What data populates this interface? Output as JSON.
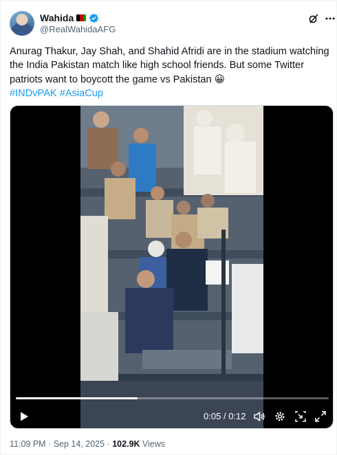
{
  "author": {
    "display_name": "Wahida",
    "handle": "@RealWahidaAFG",
    "flag_colors": [
      "#000000",
      "#be0000",
      "#009900"
    ],
    "avatar_icon": "profile-photo",
    "verified_icon": "verified-badge-icon"
  },
  "tweet": {
    "text_line1": "Anurag Thakur, Jay Shah, and Shahid Afridi are in the stadium watching",
    "text_line2": "the India Pakistan match like high school friends. But some Twitter",
    "text_line3": "patriots want to boycott the game vs Pakistan 😀",
    "hashtag1": "#INDvPAK",
    "hashtag2": "#AsiaCup"
  },
  "video": {
    "current_time": "0:05",
    "separator": "/",
    "duration": "0:12",
    "progress_fraction": 0.39,
    "controls": [
      "play-icon",
      "volume-icon",
      "settings-gear-icon",
      "picture-in-picture-icon",
      "fullscreen-icon"
    ]
  },
  "meta": {
    "time": "11:09 PM",
    "dot1": "·",
    "date": "Sep 14, 2025",
    "dot2": "·",
    "views_count": "102.9K",
    "views_label": "Views"
  },
  "colors": {
    "link": "#1d9bf0",
    "secondary_text": "#536471",
    "verified": "#1d9bf0"
  }
}
